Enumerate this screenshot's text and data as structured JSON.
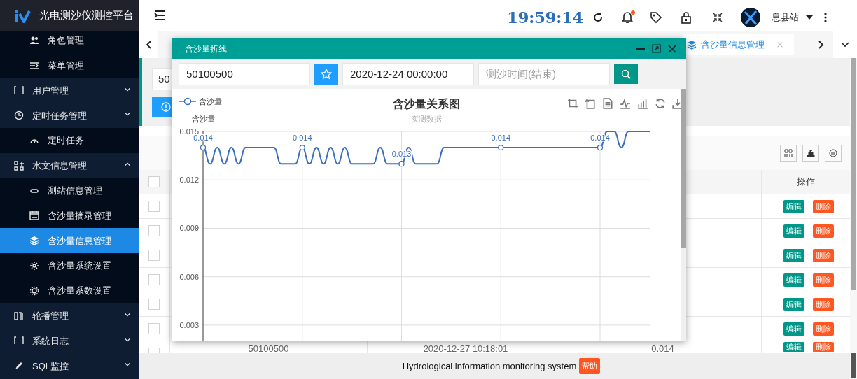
{
  "brand": {
    "title": "光电测沙仪测控平台"
  },
  "sidebar": {
    "items": [
      {
        "children": [
          {
            "label": "角色管理",
            "selected": false
          },
          {
            "label": "菜单管理",
            "selected": false
          }
        ]
      },
      {
        "label": "用户管理",
        "expanded": false,
        "selected": false
      },
      {
        "label": "定时任务管理",
        "expanded": false,
        "selected": false,
        "children": [
          {
            "label": "定时任务",
            "selected": false
          }
        ]
      },
      {
        "label": "水文信息管理",
        "expanded": true,
        "selected": false,
        "children": [
          {
            "label": "测站信息管理",
            "selected": false
          },
          {
            "label": "含沙量摘录管理",
            "selected": false
          },
          {
            "label": "含沙量信息管理",
            "selected": true
          },
          {
            "label": "含沙量系统设置",
            "selected": false
          },
          {
            "label": "含沙量系数设置",
            "selected": false
          }
        ]
      },
      {
        "label": "轮播管理",
        "expanded": false,
        "selected": false
      },
      {
        "label": "系统日志",
        "expanded": false,
        "selected": false
      },
      {
        "label": "SQL监控",
        "expanded": false,
        "selected": false
      }
    ]
  },
  "header": {
    "clock": "19:59:14",
    "notification_dot": true,
    "user": "息县站"
  },
  "tabs": [
    {
      "label": "含沙量信息管理",
      "selected": true
    }
  ],
  "filter": {
    "value": "50"
  },
  "table": {
    "header_checked": false,
    "columns": [
      {
        "label": "操作"
      }
    ],
    "rows": [
      {
        "checked": false,
        "actions": [
          {
            "kind": "edit",
            "label": "编辑"
          },
          {
            "kind": "delete",
            "label": "删除"
          }
        ]
      },
      {
        "checked": false,
        "actions": [
          {
            "kind": "edit",
            "label": "编辑"
          },
          {
            "kind": "delete",
            "label": "删除"
          }
        ]
      },
      {
        "checked": false,
        "actions": [
          {
            "kind": "edit",
            "label": "编辑"
          },
          {
            "kind": "delete",
            "label": "删除"
          }
        ]
      },
      {
        "checked": false,
        "actions": [
          {
            "kind": "edit",
            "label": "编辑"
          },
          {
            "kind": "delete",
            "label": "删除"
          }
        ]
      },
      {
        "checked": false,
        "actions": [
          {
            "kind": "edit",
            "label": "编辑"
          },
          {
            "kind": "delete",
            "label": "删除"
          }
        ]
      },
      {
        "checked": false,
        "actions": [
          {
            "kind": "edit",
            "label": "编辑"
          },
          {
            "kind": "delete",
            "label": "删除"
          }
        ]
      },
      {
        "checked": false,
        "cells": [
          "50100500",
          "2020-12-27 10:18:01",
          "0.014"
        ],
        "actions": [
          {
            "kind": "edit",
            "label": "编辑"
          },
          {
            "kind": "delete",
            "label": "删除"
          }
        ]
      }
    ]
  },
  "modal": {
    "title": "含沙量折线",
    "station": {
      "value": "50100500"
    },
    "start_time": {
      "value": "2020-12-24 00:00:00"
    },
    "end_time": {
      "placeholder": "测沙时间(结束)"
    },
    "chart_data": {
      "type": "line",
      "title": "含沙量关系图",
      "subtitle": "实测数据",
      "ylabel": "含沙量",
      "ylim": [
        0.002,
        0.015
      ],
      "yticks": [
        0.003,
        0.006,
        0.009,
        0.012,
        0.015
      ],
      "series": [
        {
          "name": "含沙量",
          "color": "#3a6fbe",
          "values": [
            0.014,
            0.013,
            0.014,
            0.013,
            0.014,
            0.013,
            0.014,
            0.014,
            0.014,
            0.014,
            0.014,
            0.013,
            0.013,
            0.013,
            0.014,
            0.013,
            0.014,
            0.013,
            0.014,
            0.013,
            0.014,
            0.013,
            0.013,
            0.013,
            0.013,
            0.014,
            0.013,
            0.013,
            0.013,
            0.014,
            0.013,
            0.013,
            0.013,
            0.013,
            0.014,
            0.014,
            0.014,
            0.014,
            0.014,
            0.014,
            0.014,
            0.014,
            0.014,
            0.014,
            0.014,
            0.014,
            0.014,
            0.014,
            0.014,
            0.014,
            0.014,
            0.014,
            0.014,
            0.014,
            0.014,
            0.014,
            0.014,
            0.015,
            0.015,
            0.014,
            0.015,
            0.015,
            0.015,
            0.015
          ]
        }
      ],
      "grid": true,
      "value_labels": [
        "0.014",
        null,
        null,
        null,
        null,
        null,
        null,
        null,
        null,
        null,
        null,
        null,
        null,
        null,
        "0.014",
        null,
        null,
        null,
        null,
        null,
        null,
        null,
        null,
        null,
        null,
        null,
        null,
        null,
        "0.013",
        null,
        null,
        null,
        null,
        null,
        null,
        null,
        null,
        null,
        null,
        null,
        null,
        null,
        "0.014",
        null,
        null,
        null,
        null,
        null,
        null,
        null,
        null,
        null,
        null,
        null,
        null,
        null,
        "0.014",
        null,
        null,
        null,
        null,
        null,
        null,
        null
      ]
    }
  },
  "footer": {
    "text": "Hydrological information monitoring system",
    "help": "帮助"
  }
}
